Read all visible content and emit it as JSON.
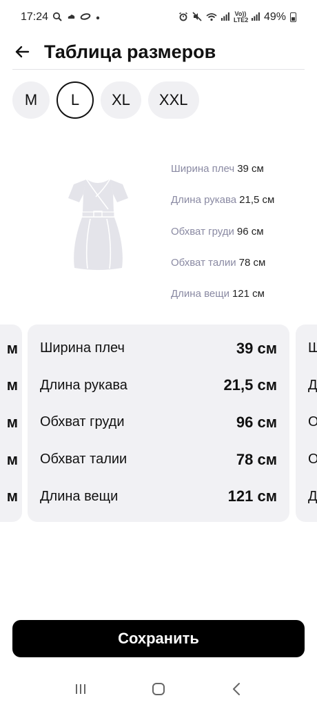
{
  "status_bar": {
    "time": "17:24",
    "battery": "49%",
    "network_label": "Vo)) LTE2"
  },
  "header": {
    "title": "Таблица размеров",
    "back_icon": "arrow-left-icon"
  },
  "sizes": [
    {
      "label": "M",
      "selected": false
    },
    {
      "label": "L",
      "selected": true
    },
    {
      "label": "XL",
      "selected": false
    },
    {
      "label": "XXL",
      "selected": false
    }
  ],
  "illustration": {
    "measurements": [
      {
        "name": "Ширина плеч",
        "value": "39 см"
      },
      {
        "name": "Длина рукава",
        "value": "21,5 см"
      },
      {
        "name": "Обхват груди",
        "value": "96 см"
      },
      {
        "name": "Обхват талии",
        "value": "78 см"
      },
      {
        "name": "Длина вещи",
        "value": "121 см"
      }
    ]
  },
  "card": {
    "rows": [
      {
        "name": "Ширина плеч",
        "value": "39 см"
      },
      {
        "name": "Длина рукава",
        "value": "21,5 см"
      },
      {
        "name": "Обхват груди",
        "value": "96 см"
      },
      {
        "name": "Обхват талии",
        "value": "78 см"
      },
      {
        "name": "Длина вещи",
        "value": "121 см"
      }
    ]
  },
  "prev_card_peek": [
    "м",
    "м",
    "м",
    "м",
    "м"
  ],
  "next_card_peek": [
    "Ш",
    "Д",
    "О",
    "О",
    "Д"
  ],
  "save_button": {
    "label": "Сохранить"
  },
  "colors": {
    "accent": "#000000",
    "chip_bg": "#f0f0f3",
    "card_bg": "#f1f1f4",
    "muted_text": "#8a8aa3"
  }
}
